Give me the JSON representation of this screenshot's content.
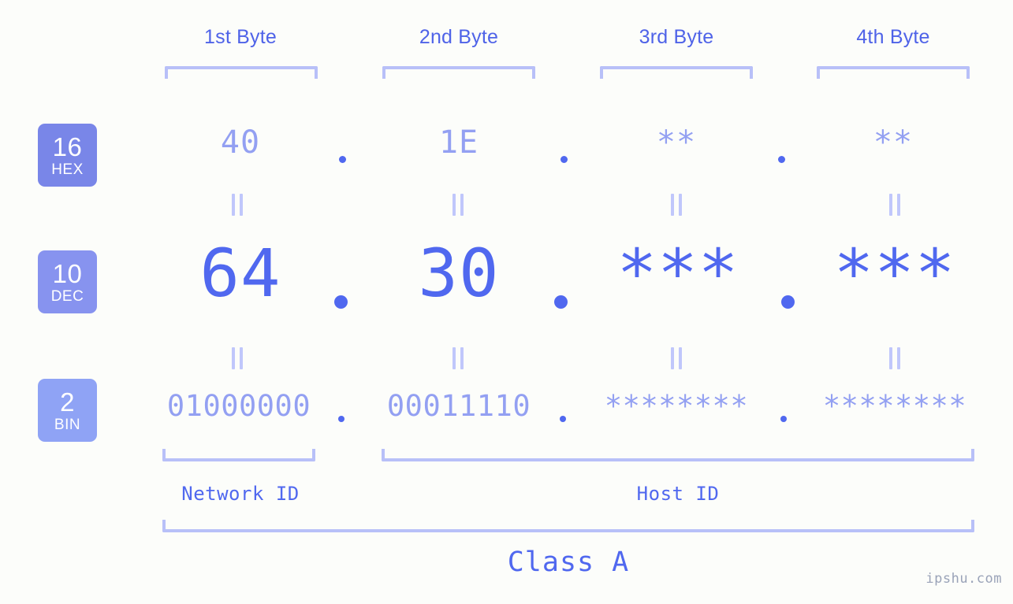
{
  "page": {
    "background_color": "#fcfdfa",
    "accent_color": "#5068ef",
    "accent_light_color": "#93a0f2",
    "bracket_color": "#b8c0f8",
    "separator_color": "#c0c7fb"
  },
  "headers": {
    "byte1": "1st Byte",
    "byte2": "2nd Byte",
    "byte3": "3rd Byte",
    "byte4": "4th Byte"
  },
  "bases": [
    {
      "number": "16",
      "abbr": "HEX",
      "badge_color": "#7986e8"
    },
    {
      "number": "10",
      "abbr": "DEC",
      "badge_color": "#8793ef"
    },
    {
      "number": "2",
      "abbr": "BIN",
      "badge_color": "#8fa3f5"
    }
  ],
  "rows": {
    "hex": {
      "label": "HEX",
      "byte1": "40",
      "byte2": "1E",
      "byte3": "**",
      "byte4": "**",
      "separator": "."
    },
    "dec": {
      "label": "DEC",
      "byte1": "64",
      "byte2": "30",
      "byte3": "***",
      "byte4": "***",
      "separator": "."
    },
    "bin": {
      "label": "BIN",
      "byte1": "01000000",
      "byte2": "00011110",
      "byte3": "********",
      "byte4": "********",
      "separator": "."
    }
  },
  "equals_marks": {
    "glyph": "||",
    "count_per_row": 4
  },
  "segments": {
    "network_id": "Network ID",
    "host_id": "Host ID",
    "class": "Class A"
  },
  "watermark": {
    "text": "ipshu.com"
  }
}
